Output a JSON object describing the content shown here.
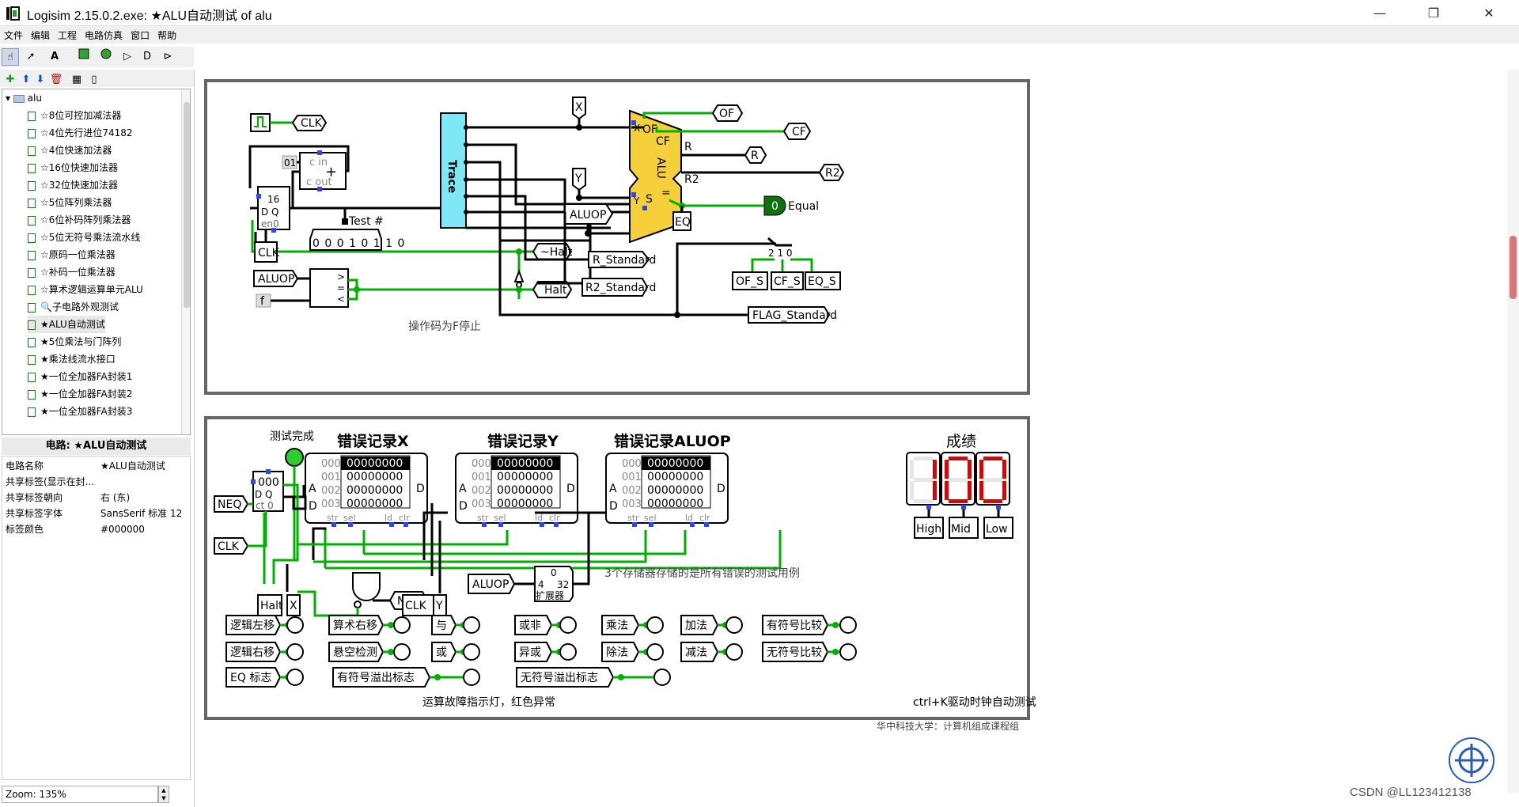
{
  "window": {
    "title": "Logisim 2.15.0.2.exe: ★ALU自动测试 of alu",
    "minimize": "—",
    "maximize": "❐",
    "close": "✕"
  },
  "menu": [
    "文件",
    "编辑",
    "工程",
    "电路仿真",
    "窗口",
    "帮助"
  ],
  "toolbar_icons": [
    "hand-poke-icon",
    "arrow-select-icon",
    "text-tool-icon",
    "input-pin-icon",
    "output-pin-icon",
    "not-gate-icon",
    "and-gate-icon",
    "or-gate-icon"
  ],
  "toolbar2_icons": [
    "add-circuit-icon",
    "move-up-icon",
    "move-down-icon",
    "delete-circuit-icon",
    "layout-icon",
    "appearance-icon"
  ],
  "tree": {
    "root": "alu",
    "items": [
      "☆8位可控加减法器",
      "☆4位先行进位74182",
      "☆4位快速加法器",
      "☆16位快速加法器",
      "☆32位快速加法器",
      "☆5位阵列乘法器",
      "☆6位补码阵列乘法器",
      "☆5位无符号乘法流水线",
      "☆原码一位乘法器",
      "☆补码一位乘法器",
      "☆算术逻辑运算单元ALU",
      "🔍子电路外观测试",
      "★ALU自动测试",
      "★5位乘法与门阵列",
      "★乘法线流水接口",
      "★一位全加器FA封装1",
      "★一位全加器FA封装2",
      "★一位全加器FA封装3"
    ],
    "selected_index": 12
  },
  "properties": {
    "title": "电路: ★ALU自动测试",
    "rows": [
      {
        "key": "电路名称",
        "value": "★ALU自动测试"
      },
      {
        "key": "共享标签(显示在封...",
        "value": ""
      },
      {
        "key": "共享标签朝向",
        "value": "右 (东)"
      },
      {
        "key": "共享标签字体",
        "value": "SansSerif 标准 12"
      },
      {
        "key": "标签颜色",
        "value": "#000000"
      }
    ]
  },
  "zoom": "Zoom: 135%",
  "watermark": "CSDN @LL123412138",
  "colors": {
    "wire_on": "#00b000",
    "wire_off": "#000000",
    "alu": "#f5d03a",
    "trace": "#7fe8f6",
    "seg_on": "#e00000",
    "led_green": "#107010"
  },
  "circuit_top": {
    "clk": "CLK",
    "counter_bits": "16",
    "dq": "D Q",
    "en": "en0",
    "adder_cin": "c in",
    "adder_cout": "c out",
    "const01": "01",
    "test_label": "Test #",
    "test_value": "0 0 0 1 0 1 1 0",
    "halt_not": "~Halt",
    "halt": "Halt",
    "aluop": "ALUOP",
    "f": "f",
    "cmp_gt": ">",
    "cmp_eq": "=",
    "cmp_lt": "<",
    "stop_note": "操作码为F停止",
    "trace": "Trace",
    "x": "X",
    "y": "Y",
    "alu_aluop": "ALUOP",
    "alu_text": "ALU",
    "alu_of": "OF",
    "alu_cf": "CF",
    "alu_r": "R",
    "alu_r2": "R2",
    "alu_s": "S",
    "alu_eq": "=",
    "alu_x": "X",
    "alu_y": "Y",
    "out_of": "OF",
    "out_cf": "CF",
    "out_r": "R",
    "out_r2": "R2",
    "equal_val": "0",
    "equal_label": "Equal",
    "eq": "EQ",
    "r_std": "R_Standard",
    "r2_std": "R2_Standard",
    "flag_std": "FLAG_Standard",
    "of_s": "OF_S",
    "cf_s": "CF_S",
    "eq_s": "EQ_S",
    "split": "2 1 0"
  },
  "circuit_bottom": {
    "done": "测试完成",
    "counter_val": "000",
    "counter_dq": "D Q",
    "counter_ct": "ct 0",
    "neq": "NEQ",
    "clk": "CLK",
    "halt": "Halt",
    "x": "X",
    "y": "Y",
    "clk2": "CLK",
    "neq2": "NEQ",
    "aluop": "ALUOP",
    "ext_in": "4",
    "ext_out": "32",
    "ext_top": "0",
    "ext_label": "扩展器",
    "mem_note": "3个存储器存储的是所有错误的测试用例",
    "ram": [
      {
        "title": "错误记录X",
        "addr": [
          "000",
          "001",
          "002",
          "003"
        ],
        "data": [
          "00000000",
          "00000000",
          "00000000",
          "00000000"
        ]
      },
      {
        "title": "错误记录Y",
        "addr": [
          "000",
          "001",
          "002",
          "003"
        ],
        "data": [
          "00000000",
          "00000000",
          "00000000",
          "00000000"
        ]
      },
      {
        "title": "错误记录ALUOP",
        "addr": [
          "000",
          "001",
          "002",
          "003"
        ],
        "data": [
          "00000000",
          "00000000",
          "00000000",
          "00000000"
        ]
      }
    ],
    "ram_a": "A",
    "ram_d": "D",
    "ram_dout": "D",
    "ram_pins": [
      "str",
      "sel",
      "ld",
      "clr"
    ],
    "score_title": "成绩",
    "score_digits": [
      "1",
      "0",
      "0"
    ],
    "score_labels": [
      "High",
      "Mid",
      "Low"
    ],
    "leds_row1": [
      "逻辑左移",
      "算术右移",
      "与",
      "或非",
      "乘法",
      "加法",
      "有符号比较"
    ],
    "leds_row2": [
      "逻辑右移",
      "悬空检测",
      "或",
      "异或",
      "除法",
      "减法",
      "无符号比较"
    ],
    "leds_row3": [
      "EQ 标志",
      "有符号溢出标志",
      "无符号溢出标志"
    ],
    "fault_note": "运算故障指示灯，红色异常",
    "drive_note": "ctrl+K驱动时钟自动测试",
    "footer_cut": "华中科技大学：计算机组成课程组"
  }
}
